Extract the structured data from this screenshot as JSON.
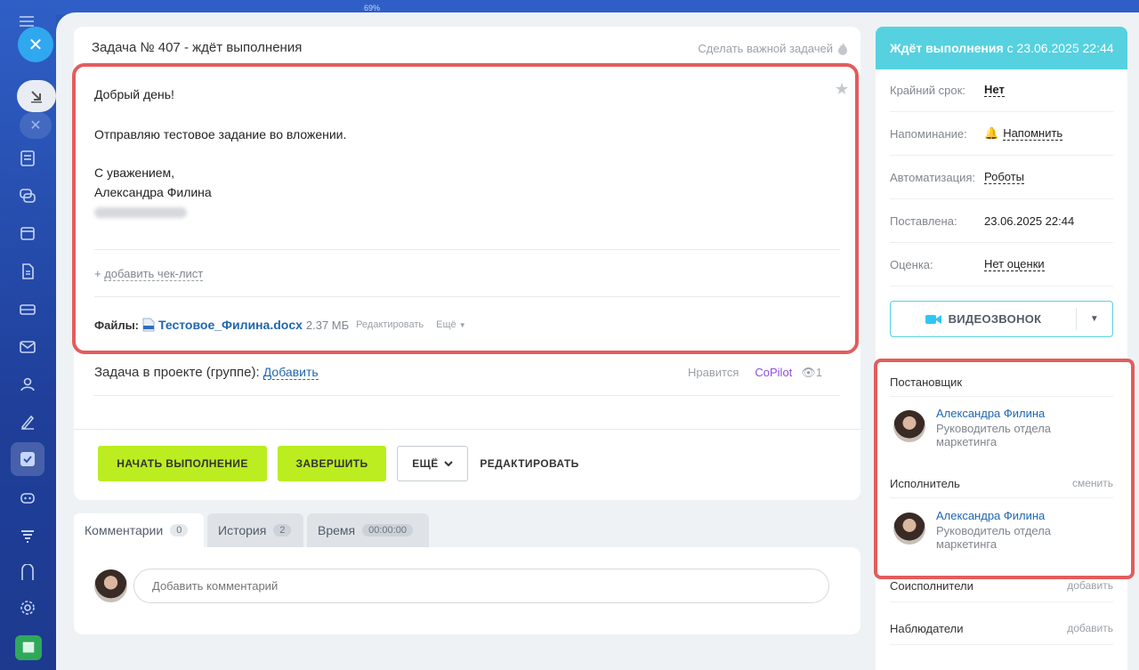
{
  "topbar": {
    "percent": "69%"
  },
  "task": {
    "title": "Задача № 407 - ждёт выполнения",
    "make_important": "Сделать важной задачей",
    "body": {
      "line1": "Добрый день!",
      "line2": "Отправляю тестовое задание во вложении.",
      "line3": "С уважением,",
      "line4": "Александра Филина"
    },
    "checklist_prefix": "+",
    "checklist_label": "добавить чек-лист",
    "files": {
      "label": "Файлы:",
      "name": "Тестовое_Филина.docx",
      "size": "2.37 МБ",
      "edit": "Редактировать",
      "more": "Ещё"
    },
    "project_label": "Задача в проекте (группе):",
    "project_add": "Добавить",
    "like": "Нравится",
    "copilot": "CoPilot",
    "views": "1"
  },
  "actions": {
    "start": "НАЧАТЬ ВЫПОЛНЕНИЕ",
    "finish": "ЗАВЕРШИТЬ",
    "more": "ЕЩЁ",
    "edit": "РЕДАКТИРОВАТЬ"
  },
  "tabs": [
    {
      "label": "Комментарии",
      "count": "0"
    },
    {
      "label": "История",
      "count": "2"
    },
    {
      "label": "Время",
      "count": "00:00:00"
    }
  ],
  "comment_placeholder": "Добавить комментарий",
  "sidebar": {
    "status_bold": "Ждёт выполнения",
    "status_rest": "с 23.06.2025 22:44",
    "deadline": {
      "key": "Крайний срок:",
      "value": "Нет"
    },
    "reminder": {
      "key": "Напоминание:",
      "value": "Напомнить"
    },
    "automation": {
      "key": "Автоматизация:",
      "value": "Роботы"
    },
    "created": {
      "key": "Поставлена:",
      "value": "23.06.2025 22:44"
    },
    "rating": {
      "key": "Оценка:",
      "value": "Нет оценки"
    },
    "video_call": "ВИДЕОЗВОНОК",
    "creator": {
      "heading": "Постановщик",
      "name": "Александра Филина",
      "role": "Руководитель отдела маркетинга"
    },
    "assignee": {
      "heading": "Исполнитель",
      "change": "сменить",
      "name": "Александра Филина",
      "role": "Руководитель отдела маркетинга"
    },
    "coexecutors": {
      "heading": "Соисполнители",
      "add": "добавить"
    },
    "observers": {
      "heading": "Наблюдатели",
      "add": "добавить"
    }
  },
  "colors": {
    "accent_green": "#bbed21",
    "status_cyan": "#56d1e0",
    "highlight_red": "#e35c5c",
    "link_blue": "#2067b0"
  }
}
